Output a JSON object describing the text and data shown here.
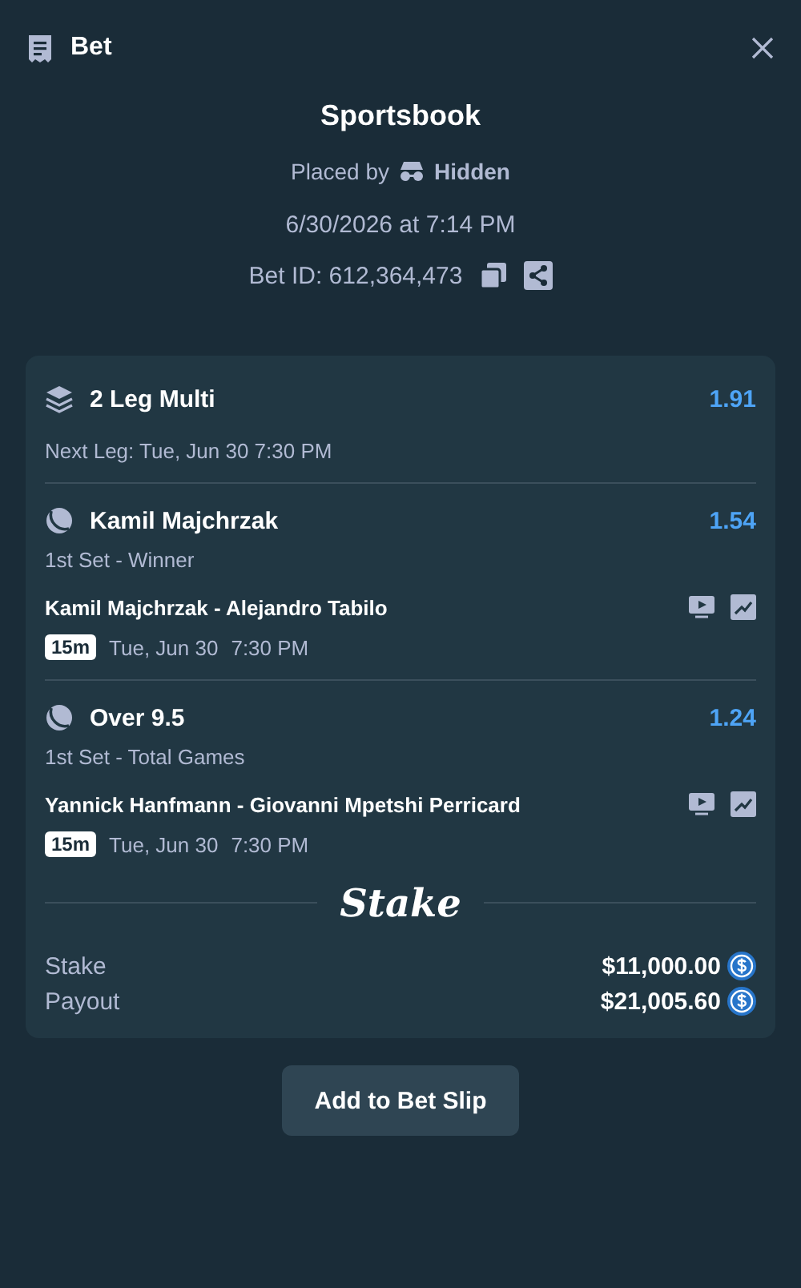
{
  "header": {
    "title": "Bet"
  },
  "summary": {
    "title": "Sportsbook",
    "placed_by_label": "Placed by",
    "placed_by_user": "Hidden",
    "datetime": "6/30/2026 at 7:14 PM",
    "bet_id": "Bet ID: 612,364,473"
  },
  "multi": {
    "title": "2 Leg Multi",
    "odds": "1.91",
    "next_leg": "Next Leg: Tue, Jun 30 7:30 PM"
  },
  "legs": [
    {
      "selection": "Kamil Majchrzak",
      "odds": "1.54",
      "market": "1st Set - Winner",
      "event": "Kamil Majchrzak - Alejandro Tabilo",
      "badge": "15m",
      "date": "Tue, Jun 30",
      "time": "7:30 PM"
    },
    {
      "selection": "Over 9.5",
      "odds": "1.24",
      "market": "1st Set - Total Games",
      "event": "Yannick Hanfmann - Giovanni Mpetshi Perricard",
      "badge": "15m",
      "date": "Tue, Jun 30",
      "time": "7:30 PM"
    }
  ],
  "logo": "Stake",
  "totals": [
    {
      "label": "Stake",
      "amount": "$11,000.00"
    },
    {
      "label": "Payout",
      "amount": "$21,005.60"
    }
  ],
  "button": "Add to Bet Slip"
}
